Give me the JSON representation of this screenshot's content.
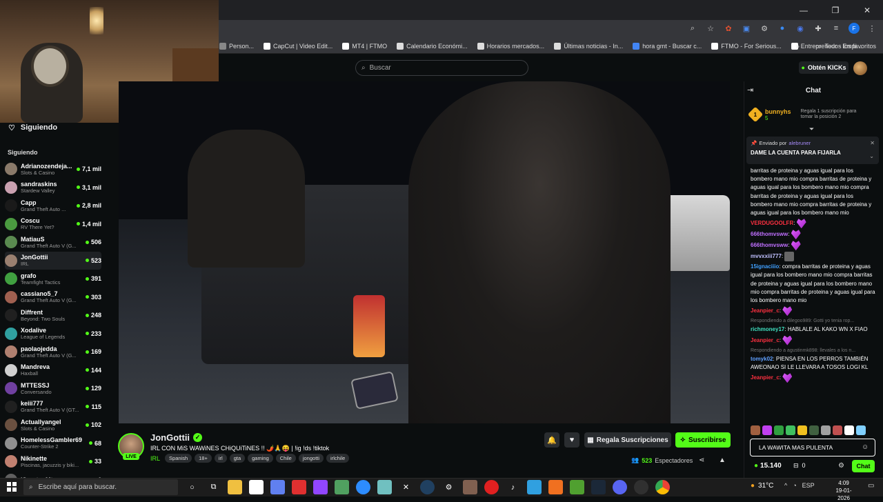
{
  "browser": {
    "bookmarks": [
      {
        "label": "Person...",
        "color": "#888"
      },
      {
        "label": "CapCut | Video Edit...",
        "color": "#ffffff"
      },
      {
        "label": "MT4 | FTMO",
        "color": "#ffffff"
      },
      {
        "label": "Calendario Económi...",
        "color": "#dddddd"
      },
      {
        "label": "Horarios mercados...",
        "color": "#dddddd"
      },
      {
        "label": "Últimas noticias - In...",
        "color": "#dddddd"
      },
      {
        "label": "hora gmt - Buscar c...",
        "color": "#4285f4"
      },
      {
        "label": "FTMO - For Serious...",
        "color": "#ffffff"
      },
      {
        "label": "Entrepreneur - Empi...",
        "color": "#ffffff"
      }
    ],
    "all_favorites": "Todos los favoritos"
  },
  "header": {
    "search_placeholder": "Buscar",
    "get_kicks": "Obtén KICKs"
  },
  "sidebar": {
    "top_label": "Siguiendo",
    "section_label": "Siguiendo",
    "channels": [
      {
        "name": "Adrianozendeja...",
        "game": "Slots & Casino",
        "viewers": "7,1 mil",
        "color": "#8a7a6a"
      },
      {
        "name": "sandraskins",
        "game": "Stardew Valley",
        "viewers": "3,1 mil",
        "color": "#c9a0b0"
      },
      {
        "name": "Capp",
        "game": "Grand Theft Auto ...",
        "viewers": "2,8 mil",
        "color": "#1a1a1a"
      },
      {
        "name": "Coscu",
        "game": "RV There Yet?",
        "viewers": "1,4 mil",
        "color": "#4a9a40"
      },
      {
        "name": "MatiauS",
        "game": "Grand Theft Auto V (G...",
        "viewers": "506",
        "color": "#5a8a50"
      },
      {
        "name": "JonGottii",
        "game": "IRL",
        "viewers": "523",
        "color": "#9a8070"
      },
      {
        "name": "grafo",
        "game": "Teamfight Tactics",
        "viewers": "391",
        "color": "#40a040"
      },
      {
        "name": "cassiano5_7",
        "game": "Grand Theft Auto V (G...",
        "viewers": "303",
        "color": "#a06050"
      },
      {
        "name": "Diffrent",
        "game": "Beyond: Two Souls",
        "viewers": "248",
        "color": "#202020"
      },
      {
        "name": "Xodalive",
        "game": "League of Legends",
        "viewers": "233",
        "color": "#30a0a0"
      },
      {
        "name": "paolaojedda",
        "game": "Grand Theft Auto V (G...",
        "viewers": "169",
        "color": "#b08070"
      },
      {
        "name": "Mandreva",
        "game": "Haxball",
        "viewers": "144",
        "color": "#d0d0d0"
      },
      {
        "name": "MTTESSJ",
        "game": "Conversando",
        "viewers": "129",
        "color": "#7040a0"
      },
      {
        "name": "keiii777",
        "game": "Grand Theft Auto V (GT...",
        "viewers": "115",
        "color": "#202020"
      },
      {
        "name": "Actuallyangel",
        "game": "Slots & Casino",
        "viewers": "102",
        "color": "#6a5040"
      },
      {
        "name": "HomelessGambler69",
        "game": "Counter-Strike 2",
        "viewers": "68",
        "color": "#909090"
      },
      {
        "name": "Nikinette",
        "game": "Piscinas, jacuzzis y biki...",
        "viewers": "33",
        "color": "#c08070"
      },
      {
        "name": "iSpartanMtz",
        "game": "",
        "viewers": "6",
        "color": "#606060"
      }
    ]
  },
  "stream": {
    "name": "JonGottii",
    "live": "LIVE",
    "title": "IRL CON MiS WAWiNES CHiQUiTiNES !! 🌶️🙏😝 | !ig !ds !tiktok",
    "category": "IRL",
    "tags": [
      "Spanish",
      "18+",
      "irl",
      "gta",
      "gaming",
      "Chile",
      "jongotti",
      "irlchile"
    ],
    "gift_subs": "Regala Suscripciones",
    "subscribe": "Suscribirse",
    "viewers_count": "523",
    "viewers_label": "Espectadores"
  },
  "chat": {
    "title": "Chat",
    "leader_name": "bunnyhs",
    "leader_rank": "1",
    "leader_count": "5",
    "leader_cta": "Regala 1 suscripción para tomar la posición 2",
    "pinned_by_label": "Enviado por",
    "pinned_by_user": "alebruner",
    "pinned_message": "DAME LA CUENTA PARA FIJARLA",
    "messages": [
      {
        "user": "",
        "color": "#ffffff",
        "text": "barritas de proteina y aguas igual para los bombero mano mio compra barritas de proteina y aguas igual para los bombero mano mio compra barritas de proteina y aguas igual para los bombero mano mio compra barritas de proteina y aguas igual para los bombero mano mio",
        "reply": ""
      },
      {
        "user": "VERDUGOOLFR",
        "color": "#ff3040",
        "text": "",
        "emote": true,
        "reply": ""
      },
      {
        "user": "666thomvsww",
        "color": "#c070ff",
        "text": "",
        "emote": true,
        "reply": ""
      },
      {
        "user": "666thomvsww",
        "color": "#c070ff",
        "text": "",
        "emote": true,
        "reply": ""
      },
      {
        "user": "mvvxxiii777",
        "color": "#c0c0ff",
        "text": "",
        "emote": false,
        "reply": ""
      },
      {
        "user": "15ignaciiio",
        "color": "#40a0ff",
        "text": "compra barritas de proteina y aguas igual para los bombero mano mio compra barritas de proteina y aguas igual para los bombero mano mio compra barritas de proteina y aguas igual para los bombero mano mio",
        "reply": ""
      },
      {
        "user": "Jeanpier_c",
        "color": "#ff3040",
        "text": "",
        "emote": true,
        "reply": ""
      },
      {
        "user": "richmoney17",
        "color": "#40e0c0",
        "text": "HABLALE AL KAKO WN X FIAO",
        "reply": "Respondiendo a dilegoo989: Gotti yo tenia rop..."
      },
      {
        "user": "Jeanpier_c",
        "color": "#ff3040",
        "text": "",
        "emote": true,
        "reply": ""
      },
      {
        "user": "tomyk02",
        "color": "#60a0ff",
        "text": "PIENSA EN LOS PERROS TAMBIÉN AWEONAO SI LE LLEVARA A TOSOS LOGI KL",
        "reply": "Respondiendo a agustinmk898: llevales a los n..."
      },
      {
        "user": "Jeanpier_c",
        "color": "#ff3040",
        "text": "",
        "emote": true,
        "reply": ""
      }
    ],
    "input_value": "LA WAWITA MAS PULENTA",
    "kicks_balance": "15.140",
    "gift_count": "0",
    "send": "Chat"
  },
  "taskbar": {
    "search_placeholder": "Escribe aquí para buscar.",
    "weather": "31°C",
    "lang": "ESP",
    "time": "4:09",
    "date": "19-01-2026"
  }
}
